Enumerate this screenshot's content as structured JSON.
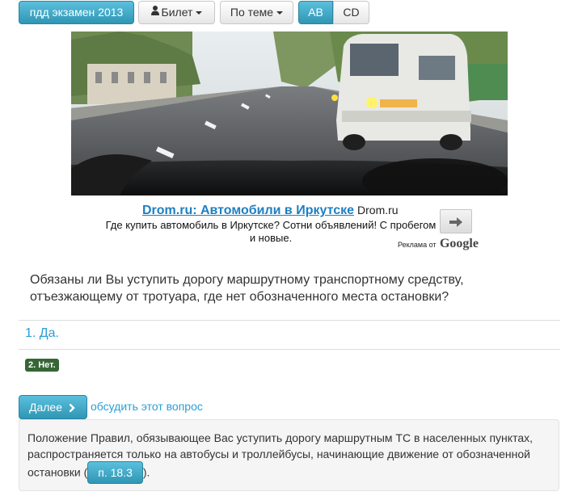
{
  "toolbar": {
    "exam_button": "пдд экзамен 2013",
    "ticket_button": "Билет",
    "topic_button": "По теме",
    "category_ab": "AB",
    "category_cd": "CD"
  },
  "ad": {
    "title": "Drom.ru: Автомобили в Иркутске",
    "domain": "Drom.ru",
    "text": "Где купить автомобиль в Иркутске? Сотни объявлений! С пробегом и новые.",
    "label_prefix": "Реклама от",
    "label_brand": "Google"
  },
  "question": {
    "text": "Обязаны ли Вы уступить дорогу маршрутному транспортному средству, отъезжающему от тротуара, где нет обозначенного места остановки?"
  },
  "answers": [
    {
      "text": "1. Да."
    },
    {
      "text": "2. Нет."
    }
  ],
  "actions": {
    "next_label": "Далее",
    "discuss_label": "обсудить этот вопрос"
  },
  "explanation": {
    "text": "Положение Правил, обязывающее Вас уступить дорогу маршрутным ТС в населенных пунктах, распространяется только на автобусы и троллейбусы, начинающие движение от обозначенной остановки (",
    "rule_label": "п. 18.3",
    "tail": ")."
  },
  "colors": {
    "primary": "#2f96b4",
    "link": "#2a9fd6",
    "correct_badge": "#356635"
  },
  "icons": {
    "ticket": "user-icon",
    "next": "chevron-right-icon",
    "ad_arrow": "arrow-right-icon"
  }
}
